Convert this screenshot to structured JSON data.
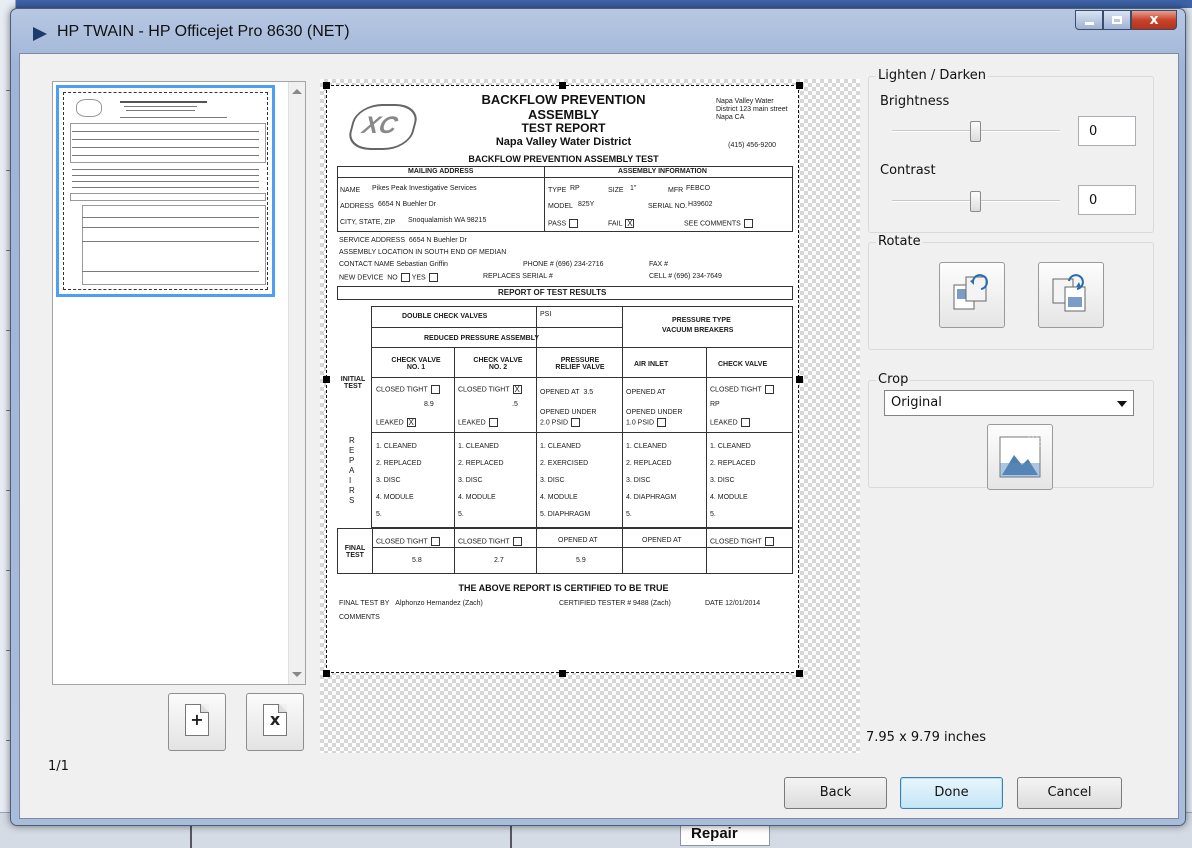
{
  "window": {
    "title": "HP TWAIN - HP Officejet Pro 8630 (NET)",
    "close_glyph": "x"
  },
  "background": {
    "repair_label": "Repair"
  },
  "thumbnails": {
    "page_count": "1/1",
    "add_glyph": "+",
    "delete_glyph": "x"
  },
  "document": {
    "title_1": "BACKFLOW PREVENTION",
    "title_2": "ASSEMBLY",
    "title_3": "TEST REPORT",
    "district": "Napa Valley Water District",
    "addr_lines": "Napa Valley Water District 123 main street Napa CA",
    "phone": "(415) 456-9200",
    "section_title": "BACKFLOW PREVENTION ASSEMBLY TEST",
    "mailing_address": "MAILING ADDRESS",
    "assembly_info": "ASSEMBLY INFORMATION",
    "name_label": "NAME",
    "name_value": "Pikes Peak Investigative Services",
    "address_label": "ADDRESS",
    "address_value": "6654 N Buehler Dr",
    "city_label": "CITY, STATE, ZIP",
    "city_value": "Snoqualamish WA 98215",
    "type_label": "TYPE",
    "type_value": "RP",
    "size_label": "SIZE",
    "size_value": "1\"",
    "mfr_label": "MFR",
    "mfr_value": "FEBCO",
    "model_label": "MODEL",
    "model_value": "825Y",
    "serial_label": "SERIAL NO.",
    "serial_value": "H39602",
    "pass_label": "PASS",
    "fail_label": "FAIL",
    "fail_mark": "X",
    "see_comments": "SEE COMMENTS",
    "service_label": "SERVICE ADDRESS",
    "service_value": "6654 N Buehler Dr",
    "location_label": "ASSEMBLY LOCATION",
    "location_value": "IN SOUTH END OF MEDIAN",
    "contact_label": "CONTACT NAME",
    "contact_value": "Sebastian Griffin",
    "phone_label": "PHONE #",
    "phone_value": "(696) 234-2716",
    "fax_label": "FAX #",
    "new_device": "NEW DEVICE",
    "no_label": "NO",
    "yes_label": "YES",
    "replaces_label": "REPLACES SERIAL #",
    "cell_label": "CELL #",
    "cell_value": "(696) 234-7649",
    "results_title": "REPORT OF TEST RESULTS",
    "double_check": "DOUBLE CHECK VALVES",
    "psi_label": "PSI",
    "pressure_type": "PRESSURE TYPE",
    "vacuum_breakers": "VACUUM BREAKERS",
    "reduced_pressure": "REDUCED PRESSURE ASSEMBLY",
    "col_headers": [
      "CHECK VALVE NO. 1",
      "CHECK VALVE NO. 2",
      "PRESSURE RELIEF VALVE",
      "AIR INLET",
      "CHECK VALVE"
    ],
    "initial_test": "INITIAL TEST",
    "closed_tight": "CLOSED TIGHT",
    "leaked": "LEAKED",
    "opened_at": "OPENED AT",
    "opened_under": "OPENED UNDER",
    "psid_under_2": "2.0 PSID",
    "psid_under_1": "1.0 PSID",
    "psid": "PSID",
    "rp_label": "RP",
    "val_cv1": "8.9",
    "val_cv2": ".5",
    "val_opened": "3.5",
    "repairs_label": "R E P A I R S",
    "repair_rows_1": [
      "1. CLEANED",
      "2. REPLACED",
      "3. DISC",
      "4. MODULE",
      "5.",
      "6."
    ],
    "repair_rows_3": [
      "1. CLEANED",
      "2. EXERCISED",
      "3. DISC",
      "4. MODULE",
      "5. DIAPHRAGM",
      "6."
    ],
    "repair_rows_4": [
      "1. CLEANED",
      "2. REPLACED",
      "3. DISC",
      "4. DIAPHRAGM",
      "5.",
      "6."
    ],
    "final_test": "FINAL TEST",
    "final_cv1": "5.8",
    "final_cv2": "2.7",
    "final_opened": "5.9",
    "certified": "THE ABOVE REPORT IS CERTIFIED TO BE TRUE",
    "final_by_label": "FINAL TEST BY",
    "final_by_value": "Alphonzo Hernandez (Zach)",
    "tester_label": "CERTIFIED TESTER #",
    "tester_value": "9488 (Zach)",
    "date_label": "DATE",
    "date_value": "12/01/2014",
    "comments_label": "COMMENTS"
  },
  "adjust": {
    "group_label": "Lighten / Darken",
    "brightness_label": "Brightness",
    "brightness_value": "0",
    "brightness_level": 0.5,
    "contrast_label": "Contrast",
    "contrast_value": "0",
    "contrast_level": 0.5
  },
  "rotate": {
    "group_label": "Rotate"
  },
  "crop": {
    "group_label": "Crop",
    "selected": "Original"
  },
  "size_text": "7.95 x 9.79 inches",
  "buttons": {
    "back": "Back",
    "done": "Done",
    "cancel": "Cancel"
  },
  "colors": {
    "selection": "#4c9ff2",
    "close_button": "#c9432a"
  }
}
